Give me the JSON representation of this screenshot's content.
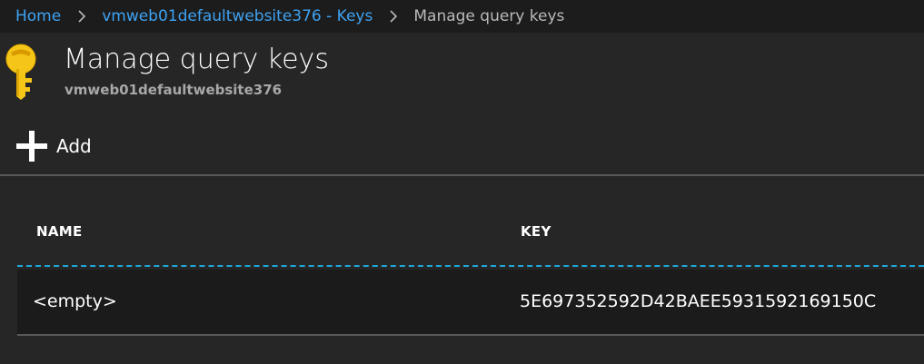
{
  "breadcrumb": {
    "items": [
      {
        "label": "Home"
      },
      {
        "label": "vmweb01defaultwebsite376 - Keys"
      },
      {
        "label": "Manage query keys"
      }
    ],
    "separator_icon": "chevron-right-icon"
  },
  "header": {
    "icon": "key-icon",
    "title": "Manage query keys",
    "subtitle": "vmweb01defaultwebsite376"
  },
  "toolbar": {
    "add_icon": "plus-icon",
    "add_label": "Add"
  },
  "table": {
    "columns": [
      "NAME",
      "KEY"
    ],
    "rows": [
      {
        "name": "<empty>",
        "key": "5E697352592D42BAEE5931592169150C"
      }
    ]
  },
  "colors": {
    "background": "#262626",
    "breadcrumb_bg": "#1c1c1c",
    "link": "#3ea2f2",
    "key_icon": "#f5c518",
    "header_divider": "#1fa8d8"
  }
}
